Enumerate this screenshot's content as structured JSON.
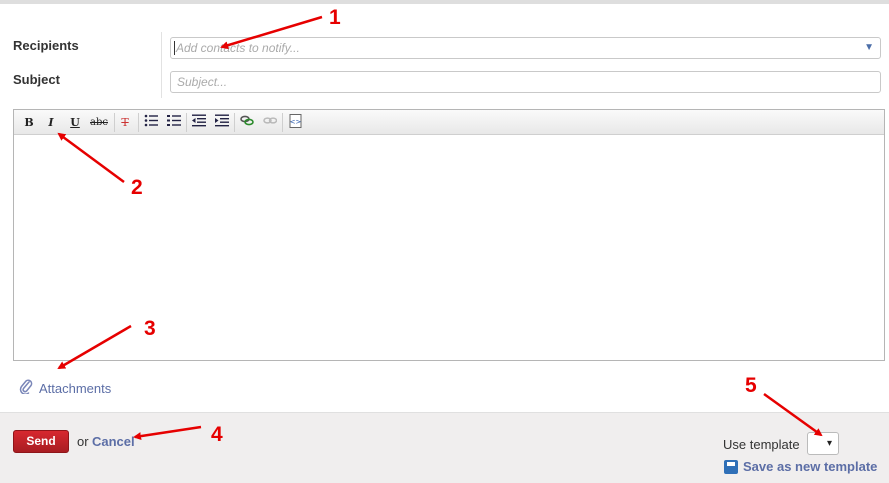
{
  "form": {
    "recipients_label": "Recipients",
    "recipients_placeholder": "Add contacts to notify...",
    "subject_label": "Subject",
    "subject_placeholder": "Subject..."
  },
  "toolbar": {
    "buttons": [
      {
        "name": "bold",
        "glyph": "B"
      },
      {
        "name": "italic",
        "glyph": "I"
      },
      {
        "name": "underline",
        "glyph": "U"
      },
      {
        "name": "strikethrough",
        "glyph": "abc"
      },
      {
        "name": "clear-format",
        "glyph": "T"
      },
      {
        "name": "bulleted-list",
        "glyph": "☰"
      },
      {
        "name": "numbered-list",
        "glyph": "☰"
      },
      {
        "name": "outdent",
        "glyph": "⇤"
      },
      {
        "name": "indent",
        "glyph": "⇥"
      },
      {
        "name": "link",
        "glyph": "⛓"
      },
      {
        "name": "unlink",
        "glyph": "⛓"
      },
      {
        "name": "source",
        "glyph": "‹›"
      }
    ]
  },
  "attachments": {
    "label": "Attachments"
  },
  "footer": {
    "send_label": "Send",
    "or_text": "or",
    "cancel_label": "Cancel",
    "use_template_label": "Use template",
    "template_value": "▾",
    "save_template_label": "Save as new template"
  },
  "annotations": [
    "1",
    "2",
    "3",
    "4",
    "5"
  ],
  "colors": {
    "annotation": "#e60000",
    "link": "#5c6ea6",
    "send": "#c62228"
  }
}
